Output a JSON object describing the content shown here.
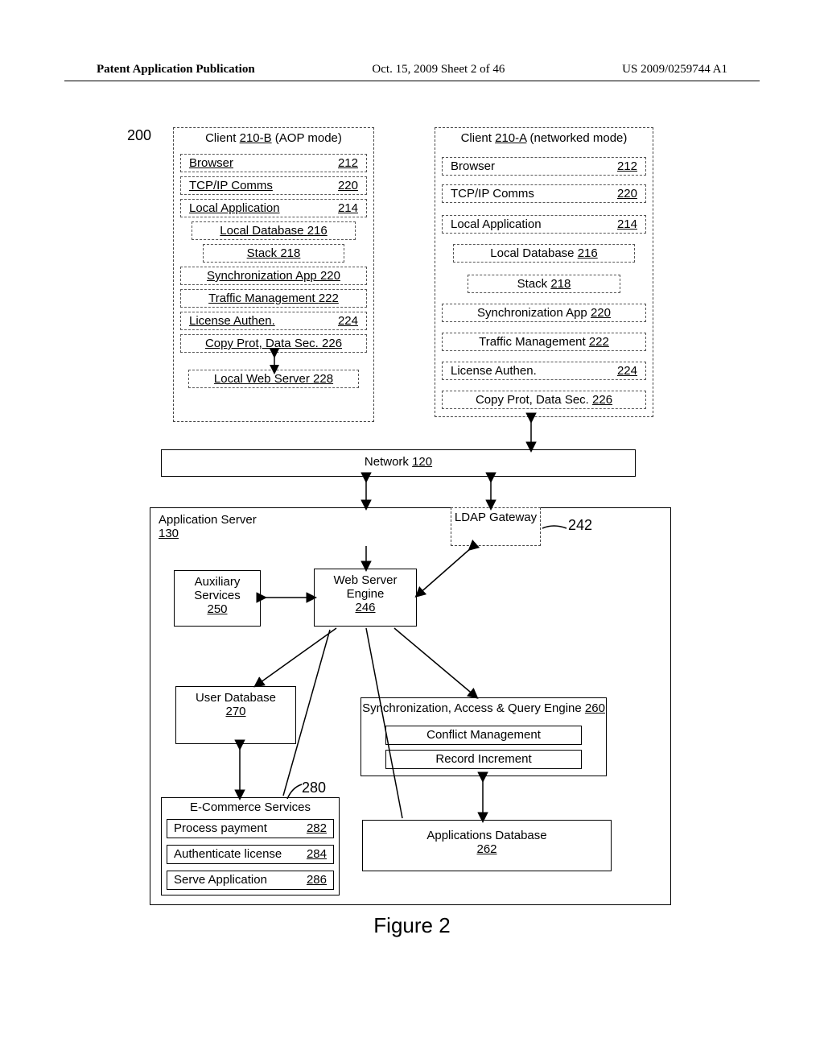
{
  "header": {
    "left": "Patent Application Publication",
    "center": "Oct. 15, 2009  Sheet 2 of 46",
    "right": "US 2009/0259744 A1"
  },
  "figure_label": "Figure 2",
  "ref_200": "200",
  "ref_242": "242",
  "ref_280": "280",
  "client_b": {
    "title_prefix": "Client ",
    "title_num": "210-B",
    "title_suffix": " (AOP mode)",
    "rows": [
      {
        "label": "Browser",
        "num": "212"
      },
      {
        "label": "TCP/IP Comms",
        "num": "220"
      },
      {
        "label": "Local Application",
        "num": "214"
      },
      {
        "label": "Local Database ",
        "num": "216"
      },
      {
        "label": "Stack ",
        "num": "218"
      },
      {
        "label": "Synchronization App ",
        "num": "220"
      },
      {
        "label": "Traffic Management ",
        "num": "222"
      },
      {
        "label": "License Authen.",
        "num": "224"
      },
      {
        "label": "Copy Prot, Data Sec. ",
        "num": "226"
      }
    ],
    "local_web_server": {
      "label": "Local Web Server ",
      "num": "228"
    }
  },
  "client_a": {
    "title_prefix": "Client  ",
    "title_num": "210-A",
    "title_suffix": " (networked mode)",
    "rows": [
      {
        "label": "Browser",
        "num": "212"
      },
      {
        "label": "TCP/IP Comms",
        "num": "220"
      },
      {
        "label": "Local Application",
        "num": "214"
      },
      {
        "label": "Local Database ",
        "num": "216"
      },
      {
        "label": "Stack ",
        "num": "218"
      },
      {
        "label": "Synchronization App ",
        "num": "220"
      },
      {
        "label": "Traffic Management ",
        "num": "222"
      },
      {
        "label": "License Authen.",
        "num": "224"
      },
      {
        "label": "Copy Prot, Data Sec. ",
        "num": "226"
      }
    ]
  },
  "network": {
    "label": "Network ",
    "num": "120"
  },
  "app_server": {
    "label": "Application Server",
    "num": "130"
  },
  "aux": {
    "label": "Auxiliary Services",
    "num": "250"
  },
  "web_engine": {
    "label": "Web Server Engine",
    "num": "246"
  },
  "ldap": {
    "label": "LDAP Gateway"
  },
  "user_db": {
    "label": "User Database",
    "num": "270"
  },
  "sync_engine": {
    "label": "Synchronization, Access & Query Engine  ",
    "num": "260",
    "sub1": "Conflict Management",
    "sub2": "Record Increment"
  },
  "ecommerce": {
    "title": "E-Commerce Services",
    "r1": {
      "label": "Process payment",
      "num": "282"
    },
    "r2": {
      "label": "Authenticate license  ",
      "num": "284"
    },
    "r3": {
      "label": "Serve Application",
      "num": "286"
    }
  },
  "apps_db": {
    "label": "Applications Database",
    "num": "262"
  }
}
